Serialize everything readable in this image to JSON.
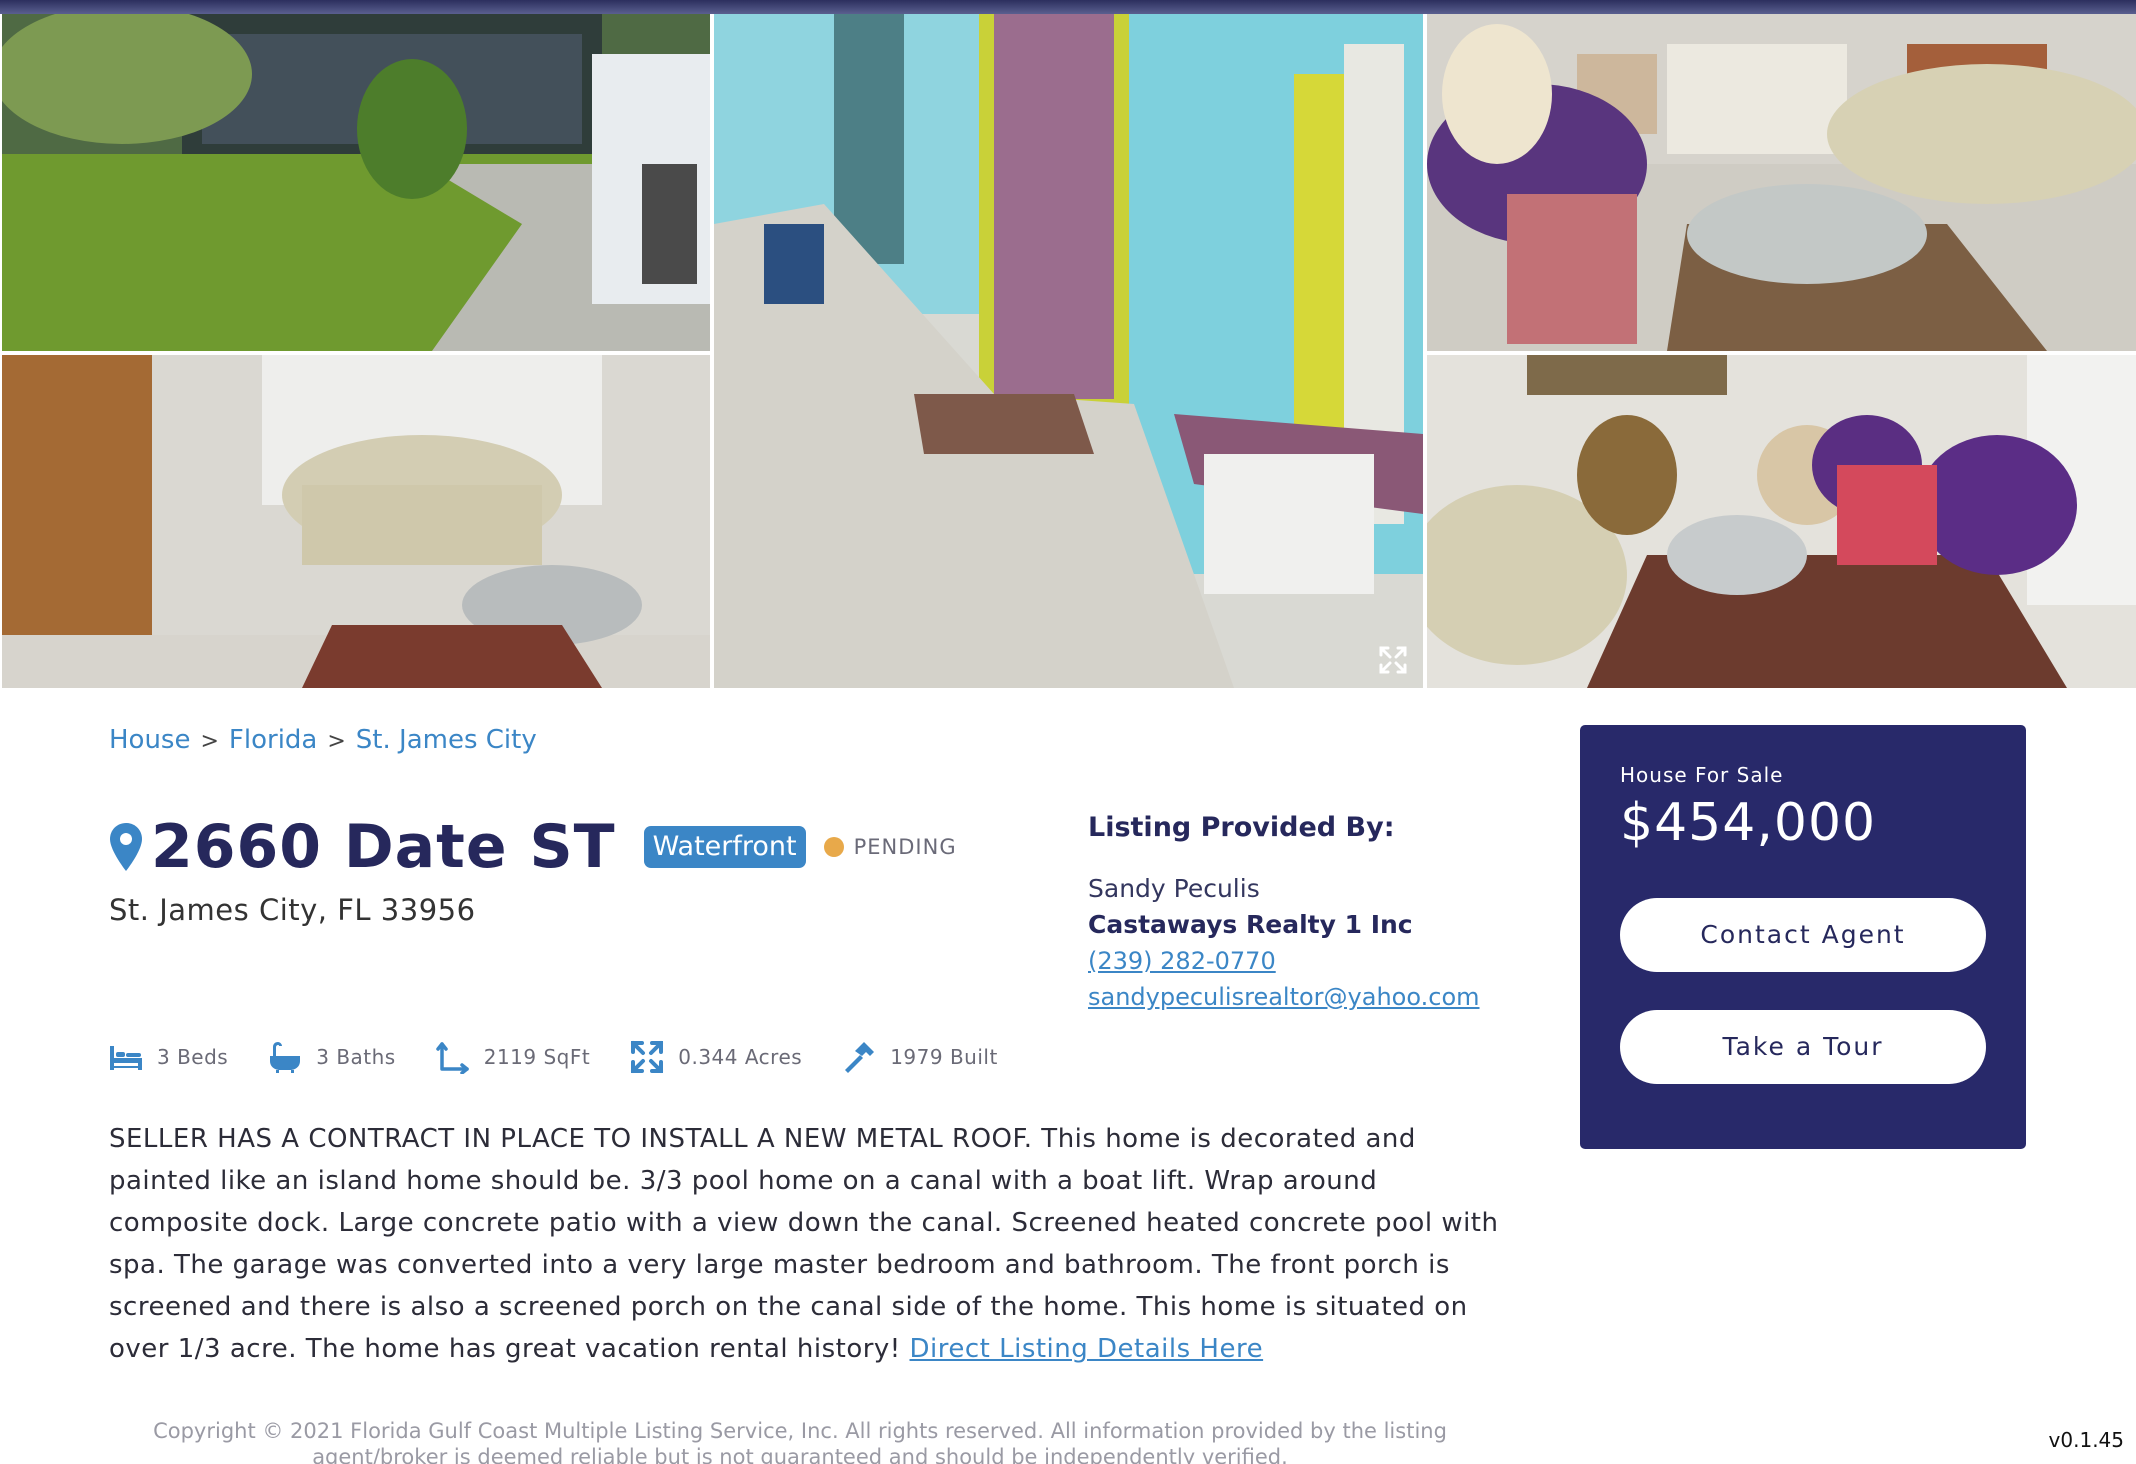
{
  "breadcrumb": {
    "items": [
      "House",
      "Florida",
      "St. James City"
    ],
    "separator": ">"
  },
  "listing": {
    "street": "2660 Date ST",
    "badge": "Waterfront",
    "status": "PENDING",
    "city_state_zip": "St. James City, FL 33956"
  },
  "provider": {
    "heading": "Listing Provided By:",
    "agent": "Sandy Peculis",
    "office": "Castaways Realty 1 Inc",
    "phone": "(239) 282-0770",
    "email": "sandypeculisrealtor@yahoo.com"
  },
  "features": {
    "beds": "3 Beds",
    "baths": "3 Baths",
    "sqft": "2119 SqFt",
    "acres": "0.344 Acres",
    "built": "1979 Built"
  },
  "description": {
    "text": "SELLER HAS A CONTRACT IN PLACE TO INSTALL A NEW METAL ROOF. This home is decorated and painted like an island home should be. 3/3 pool home on a canal with a boat lift. Wrap around composite dock. Large concrete patio with a view down the canal. Screened heated concrete pool with spa. The garage was converted into a very large master bedroom and bathroom. The front porch is screened and there is also a screened porch on the canal side of the home. This home is situated on over 1/3 acre. The home has great vacation rental history! ",
    "link": "Direct Listing Details Here"
  },
  "price_card": {
    "label": "House For Sale",
    "price": "$454,000",
    "contact_button": "Contact Agent",
    "tour_button": "Take a Tour"
  },
  "footer": {
    "copyright": "Copyright © 2021 Florida Gulf Coast Multiple Listing Service, Inc. All rights reserved. All information provided by the listing agent/broker is deemed reliable but is not guaranteed and should be independently verified.",
    "version": "v0.1.45"
  },
  "colors": {
    "brand_navy": "#28296a",
    "link_blue": "#3b86c6",
    "pending_dot": "#e8a94a"
  },
  "icons": {
    "location": "pin-icon",
    "beds": "bed-icon",
    "baths": "bathtub-icon",
    "sqft": "area-icon",
    "acres": "expand-arrows-icon",
    "built": "hammer-icon",
    "gallery_expand": "fullscreen-icon"
  }
}
